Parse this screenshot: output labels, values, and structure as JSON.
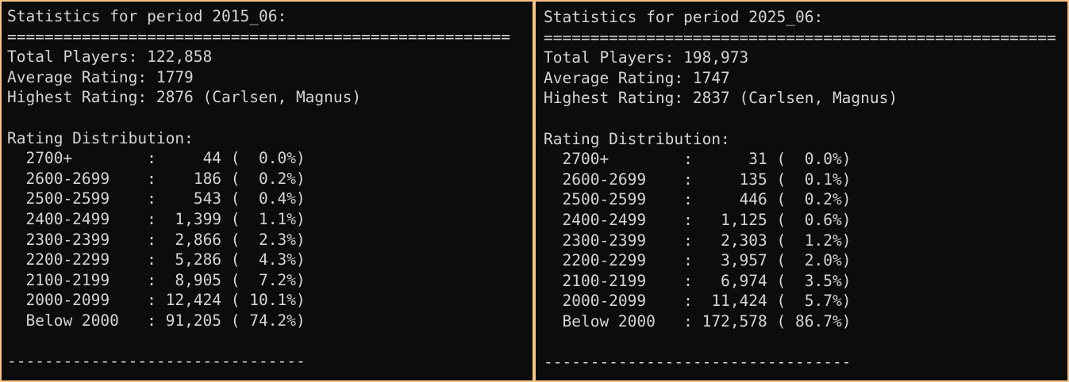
{
  "panels": [
    {
      "title": "Statistics for period 2015_06:",
      "separator": "======================================================",
      "total_players": "Total Players: 122,858",
      "average_rating": "Average Rating: 1779",
      "highest_rating": "Highest Rating: 2876 (Carlsen, Magnus)",
      "distribution_title": "Rating Distribution:",
      "count_width": 6,
      "rows": [
        {
          "label": "2700+",
          "count": "44",
          "pct": "0.0"
        },
        {
          "label": "2600-2699",
          "count": "186",
          "pct": "0.2"
        },
        {
          "label": "2500-2599",
          "count": "543",
          "pct": "0.4"
        },
        {
          "label": "2400-2499",
          "count": "1,399",
          "pct": "1.1"
        },
        {
          "label": "2300-2399",
          "count": "2,866",
          "pct": "2.3"
        },
        {
          "label": "2200-2299",
          "count": "5,286",
          "pct": "4.3"
        },
        {
          "label": "2100-2199",
          "count": "8,905",
          "pct": "7.2"
        },
        {
          "label": "2000-2099",
          "count": "12,424",
          "pct": "10.1"
        },
        {
          "label": "Below 2000",
          "count": "91,205",
          "pct": "74.2"
        }
      ],
      "footer": "--------------------------------"
    },
    {
      "title": "Statistics for period 2025_06:",
      "separator": "=======================================================",
      "total_players": "Total Players: 198,973",
      "average_rating": "Average Rating: 1747",
      "highest_rating": "Highest Rating: 2837 (Carlsen, Magnus)",
      "distribution_title": "Rating Distribution:",
      "count_width": 7,
      "rows": [
        {
          "label": "2700+",
          "count": "31",
          "pct": "0.0"
        },
        {
          "label": "2600-2699",
          "count": "135",
          "pct": "0.1"
        },
        {
          "label": "2500-2599",
          "count": "446",
          "pct": "0.2"
        },
        {
          "label": "2400-2499",
          "count": "1,125",
          "pct": "0.6"
        },
        {
          "label": "2300-2399",
          "count": "2,303",
          "pct": "1.2"
        },
        {
          "label": "2200-2299",
          "count": "3,957",
          "pct": "2.0"
        },
        {
          "label": "2100-2199",
          "count": "6,974",
          "pct": "3.5"
        },
        {
          "label": "2000-2099",
          "count": "11,424",
          "pct": "5.7"
        },
        {
          "label": "Below 2000",
          "count": "172,578",
          "pct": "86.7"
        }
      ],
      "footer": "---------------------------------"
    }
  ]
}
